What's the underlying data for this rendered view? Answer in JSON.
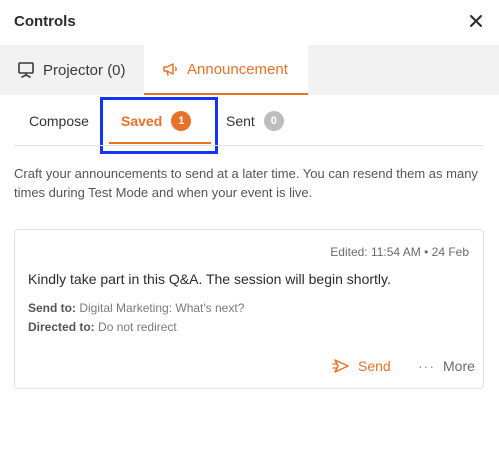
{
  "header": {
    "title": "Controls",
    "close_icon": "close-icon"
  },
  "main_tabs": [
    {
      "label": "Projector (0)",
      "icon": "projector-icon",
      "active": false
    },
    {
      "label": "Announcement",
      "icon": "megaphone-icon",
      "active": true
    }
  ],
  "sub_tabs": {
    "compose": {
      "label": "Compose"
    },
    "saved": {
      "label": "Saved",
      "count": "1",
      "active": true
    },
    "sent": {
      "label": "Sent",
      "count": "0"
    }
  },
  "description": "Craft your announcements to send at a later time. You can resend them as many times during Test Mode and when your event is live.",
  "announcement": {
    "edited": "Edited: 11:54 AM • 24 Feb",
    "message": "Kindly take part in this Q&A. The session will begin shortly.",
    "send_to_label": "Send to:",
    "send_to_value": "Digital Marketing: What's next?",
    "directed_to_label": "Directed to:",
    "directed_to_value": "Do not redirect",
    "send_label": "Send",
    "more_label": "More"
  },
  "colors": {
    "accent": "#e8712a",
    "highlight_box": "#1336f5",
    "tabbar_bg": "#f2f2f2",
    "badge_grey": "#bdbdbd"
  }
}
